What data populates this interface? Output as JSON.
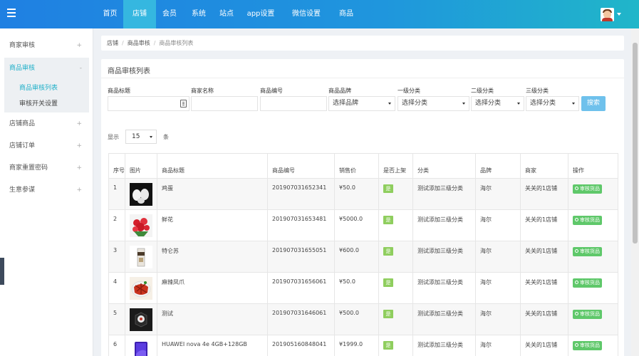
{
  "nav": {
    "items": [
      "首页",
      "店铺",
      "会员",
      "系统",
      "站点",
      "app设置",
      "微信设置",
      "商品"
    ]
  },
  "sidebar": {
    "groups": [
      {
        "label": "商家审核"
      },
      {
        "label": "商品审核"
      },
      {
        "label": "店铺商品"
      },
      {
        "label": "店铺订单"
      },
      {
        "label": "商家重置密码"
      },
      {
        "label": "生意参谋"
      }
    ],
    "sub_items": [
      "商品审核列表",
      "审核开关设置"
    ],
    "expand_glyph": "+",
    "collapse_glyph": "-"
  },
  "breadcrumb": {
    "items": [
      "店铺",
      "商品审核",
      "商品审核列表"
    ],
    "separator": "/"
  },
  "panel": {
    "title": "商品审核列表"
  },
  "filters": {
    "labels": [
      "商品标题",
      "商家名称",
      "商品编号",
      "商品品牌",
      "一级分类",
      "二级分类",
      "三级分类"
    ],
    "brand_select": "选择品牌",
    "cat1_select": "选择分类",
    "cat2_select": "选择分类",
    "cat3_select": "选择分类",
    "search_label": "搜索"
  },
  "pagination": {
    "show_label": "显示",
    "page_size": "15",
    "unit_label": "条"
  },
  "table": {
    "headers": [
      "序号",
      "图片",
      "商品标题",
      "商品编号",
      "销售价",
      "是否上架",
      "分类",
      "品牌",
      "商家",
      "操作"
    ],
    "shelf_badge": "是",
    "action_label": "审核货品",
    "rows": [
      {
        "seq": "1",
        "image": "eggs",
        "title": "鸡蛋",
        "code": "201907031652341",
        "price": "¥50.0",
        "category": "测试添加三级分类",
        "brand": "海尔",
        "shop": "关关的1店铺"
      },
      {
        "seq": "2",
        "image": "flowers",
        "title": "鲜花",
        "code": "201907031653481",
        "price": "¥5000.0",
        "category": "测试添加三级分类",
        "brand": "海尔",
        "shop": "关关的1店铺"
      },
      {
        "seq": "3",
        "image": "milk-tea",
        "title": "特仑苏",
        "code": "201907031655051",
        "price": "¥600.0",
        "category": "测试添加三级分类",
        "brand": "海尔",
        "shop": "关关的1店铺"
      },
      {
        "seq": "4",
        "image": "duck-feet",
        "title": "麻辣凤爪",
        "code": "201907031656061",
        "price": "¥50.0",
        "category": "测试添加三级分类",
        "brand": "海尔",
        "shop": "关关的1店铺"
      },
      {
        "seq": "5",
        "image": "product-box",
        "title": "测试",
        "code": "201907031646061",
        "price": "¥500.0",
        "category": "测试添加三级分类",
        "brand": "海尔",
        "shop": "关关的1店铺"
      },
      {
        "seq": "6",
        "image": "smartphone",
        "title": "HUAWEI nova 4e 4GB+128GB",
        "code": "201905160848041",
        "price": "¥1999.0",
        "category": "测试添加三级分类",
        "brand": "海尔",
        "shop": "关关的1店铺"
      }
    ]
  }
}
